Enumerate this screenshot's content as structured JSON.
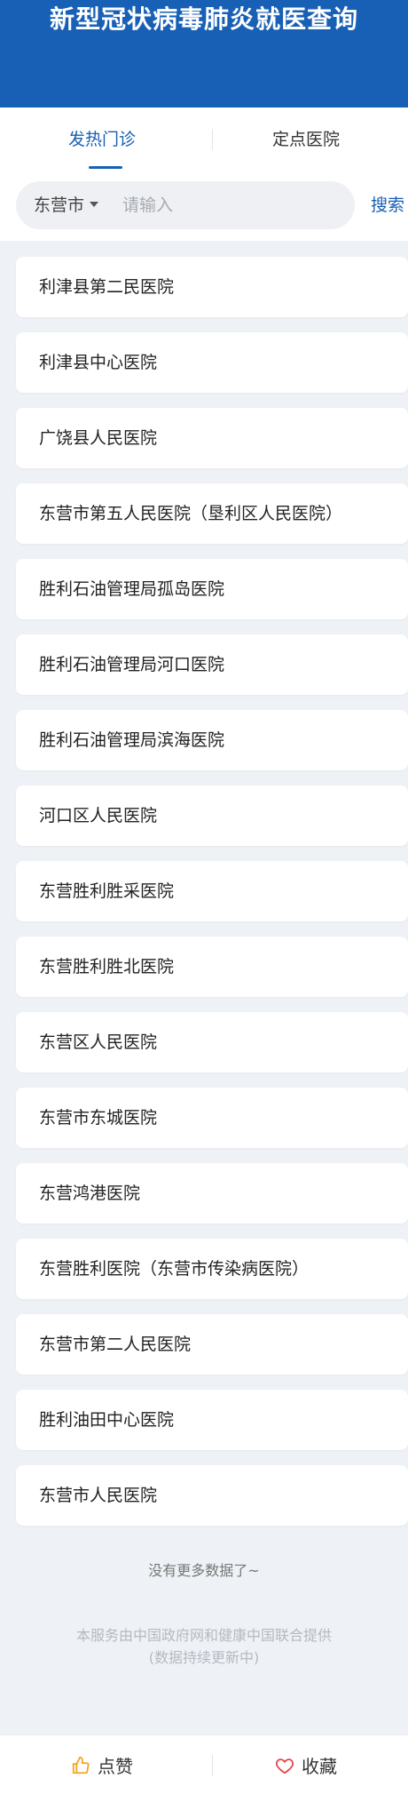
{
  "header": {
    "title": "新型冠状病毒肺炎就医查询"
  },
  "tabs": [
    {
      "label": "发热门诊"
    },
    {
      "label": "定点医院"
    }
  ],
  "search": {
    "city": "东营市",
    "placeholder": "请输入",
    "value": "",
    "button_label": "搜索"
  },
  "hospitals": [
    "利津县第二民医院",
    "利津县中心医院",
    "广饶县人民医院",
    "东营市第五人民医院（垦利区人民医院）",
    "胜利石油管理局孤岛医院",
    "胜利石油管理局河口医院",
    "胜利石油管理局滨海医院",
    "河口区人民医院",
    "东营胜利胜采医院",
    "东营胜利胜北医院",
    "东营区人民医院",
    "东营市东城医院",
    "东营鸿港医院",
    "东营胜利医院（东营市传染病医院）",
    "东营市第二人民医院",
    "胜利油田中心医院",
    "东营市人民医院"
  ],
  "no_more": "没有更多数据了~",
  "footer": {
    "line1": "本服务由中国政府网和健康中国联合提供",
    "line2": "(数据持续更新中)"
  },
  "bottom_bar": {
    "like_label": "点赞",
    "fav_label": "收藏",
    "like_icon": "thumbs-up-icon",
    "fav_icon": "heart-icon"
  },
  "colors": {
    "brand": "#1760b5",
    "accent_icon": "#f5a623",
    "fav_icon": "#e64545"
  }
}
